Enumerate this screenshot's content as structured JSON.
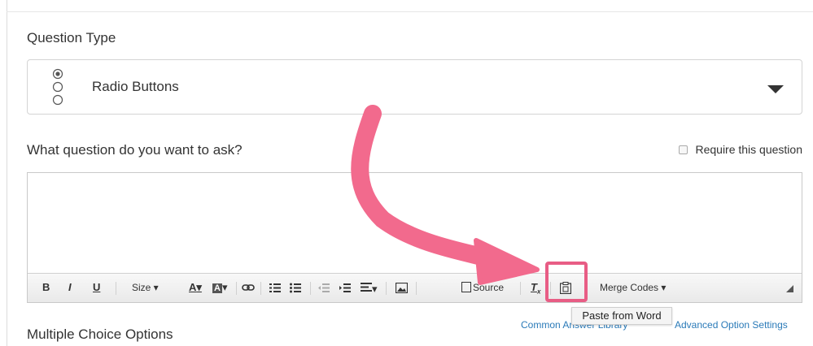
{
  "question_type": {
    "label": "Question Type",
    "selected": "Radio Buttons"
  },
  "question_prompt": {
    "label": "What question do you want to ask?",
    "require_label": "Require this question",
    "require_checked": false
  },
  "toolbar": {
    "bold": "B",
    "italic": "I",
    "underline": "U",
    "size": "Size",
    "text_color": "A",
    "bg_color": "A",
    "source": "Source",
    "merge_codes": "Merge Codes",
    "paste_tooltip": "Paste from Word"
  },
  "footer": {
    "mc_label": "Multiple Choice Options",
    "common_answer_library": "Common Answer Library",
    "advanced_option_settings": "Advanced Option Settings"
  },
  "colors": {
    "annotation": "#f26a8d",
    "link": "#2a7ab8"
  },
  "icons": [
    "radio-buttons-icon",
    "dropdown-arrow-icon",
    "link-icon",
    "numbered-list-icon",
    "bullet-list-icon",
    "outdent-icon",
    "indent-icon",
    "align-icon",
    "image-icon",
    "source-icon",
    "remove-format-icon",
    "paste-from-word-icon",
    "resize-grip-icon"
  ]
}
